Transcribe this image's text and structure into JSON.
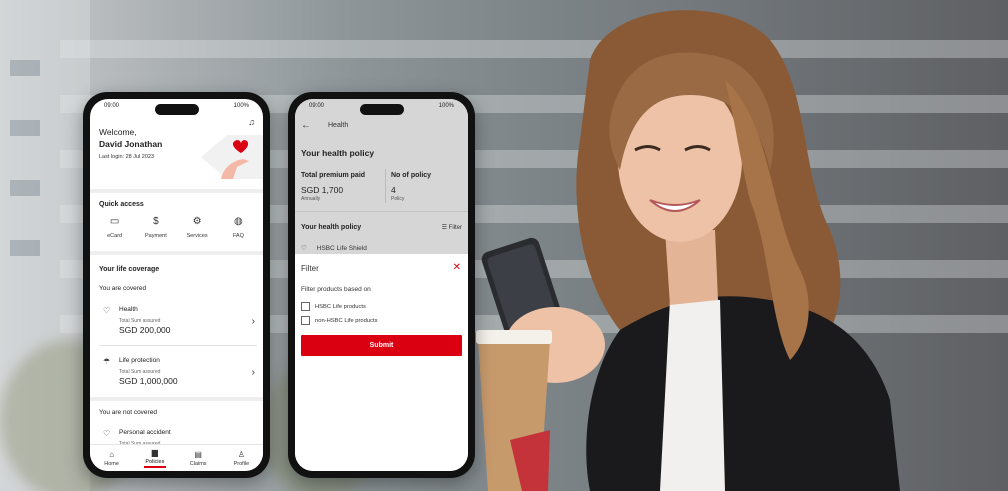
{
  "colors": {
    "brand_red": "#db0011",
    "jacket": "#1a1a1c",
    "hair": "#8a5a36"
  },
  "phone1": {
    "status": {
      "time": "09:00",
      "battery": "100%"
    },
    "welcome": "Welcome,",
    "name": "David Jonathan",
    "last_login": "Last login: 28 Jul 2023",
    "quick_access": {
      "title": "Quick access",
      "items": [
        {
          "label": "eCard",
          "icon": "card-icon"
        },
        {
          "label": "Payment",
          "icon": "dollar-icon"
        },
        {
          "label": "Services",
          "icon": "gear-icon"
        },
        {
          "label": "FAQ",
          "icon": "lightbulb-icon"
        }
      ]
    },
    "coverage": {
      "title": "Your life coverage",
      "covered_label": "You are covered",
      "covered": [
        {
          "title": "Health",
          "sub": "Total Sum assured",
          "value": "SGD 200,000",
          "icon": "heart-icon"
        },
        {
          "title": "Life protection",
          "sub": "Total Sum assured",
          "value": "SGD 1,000,000",
          "icon": "umbrella-icon"
        }
      ],
      "not_covered_label": "You are not covered",
      "not_covered": [
        {
          "title": "Personal accident",
          "sub": "Total Sum assured",
          "icon": "heart-icon"
        }
      ]
    },
    "nav": [
      {
        "label": "Home",
        "icon": "home-icon"
      },
      {
        "label": "Policies",
        "icon": "briefcase-icon"
      },
      {
        "label": "Claims",
        "icon": "document-icon"
      },
      {
        "label": "Profile",
        "icon": "person-icon"
      }
    ]
  },
  "phone2": {
    "status": {
      "time": "09:00",
      "battery": "100%"
    },
    "header": "Health",
    "title": "Your health policy",
    "premium": {
      "label": "Total premium paid",
      "value": "SGD 1,700",
      "sub": "Annually"
    },
    "policies": {
      "label": "No of policy",
      "value": "4",
      "sub": "Policy"
    },
    "section": "Your health policy",
    "filter_label": "Filter",
    "product": "HSBC Life Shield",
    "sheet": {
      "title": "Filter",
      "based_on": "Filter products based on",
      "options": [
        "HSBC Life products",
        "non-HSBC Life products"
      ],
      "submit": "Submit"
    }
  }
}
